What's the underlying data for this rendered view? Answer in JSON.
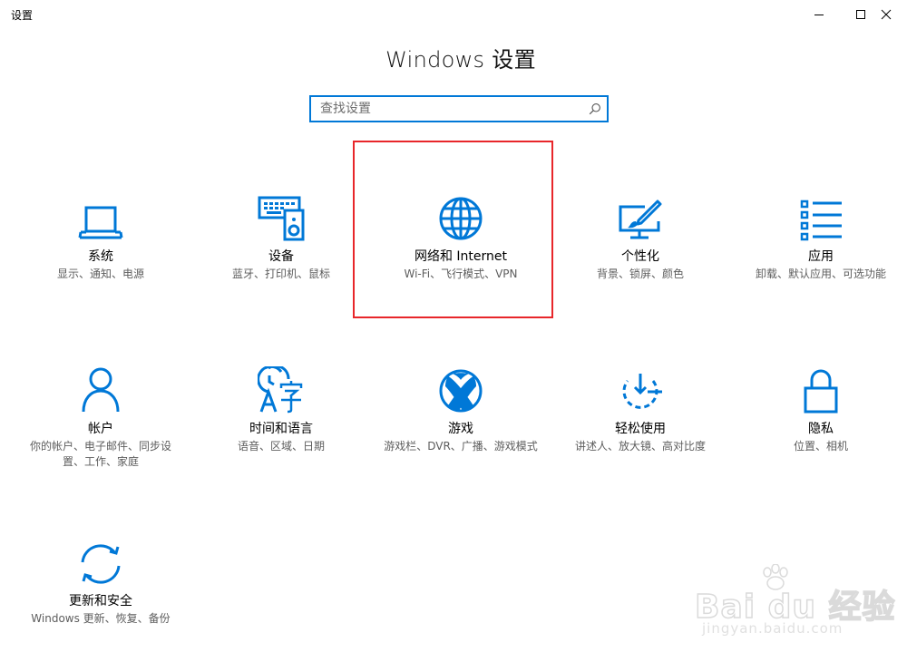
{
  "window": {
    "title": "设置"
  },
  "header": {
    "title": "Windows 设置"
  },
  "search": {
    "placeholder": "查找设置"
  },
  "colors": {
    "accent": "#0078d7",
    "highlight": "#e8262a",
    "desc_text": "#5d5d5d"
  },
  "tiles": [
    {
      "label": "系统",
      "desc": "显示、通知、电源",
      "icon": "laptop-icon"
    },
    {
      "label": "设备",
      "desc": "蓝牙、打印机、鼠标",
      "icon": "devices-icon"
    },
    {
      "label": "网络和 Internet",
      "desc": "Wi-Fi、飞行模式、VPN",
      "icon": "globe-icon"
    },
    {
      "label": "个性化",
      "desc": "背景、锁屏、颜色",
      "icon": "personalization-icon"
    },
    {
      "label": "应用",
      "desc": "卸载、默认应用、可选功能",
      "icon": "apps-list-icon"
    },
    {
      "label": "帐户",
      "desc": "你的帐户、电子邮件、同步设置、工作、家庭",
      "icon": "person-icon"
    },
    {
      "label": "时间和语言",
      "desc": "语音、区域、日期",
      "icon": "time-language-icon"
    },
    {
      "label": "游戏",
      "desc": "游戏栏、DVR、广播、游戏模式",
      "icon": "xbox-icon"
    },
    {
      "label": "轻松使用",
      "desc": "讲述人、放大镜、高对比度",
      "icon": "ease-of-access-icon"
    },
    {
      "label": "隐私",
      "desc": "位置、相机",
      "icon": "lock-icon"
    },
    {
      "label": "更新和安全",
      "desc": "Windows 更新、恢复、备份",
      "icon": "update-sync-icon"
    }
  ],
  "watermark": {
    "brand": "Bai du 经验",
    "url": "jingyan.baidu.com"
  }
}
